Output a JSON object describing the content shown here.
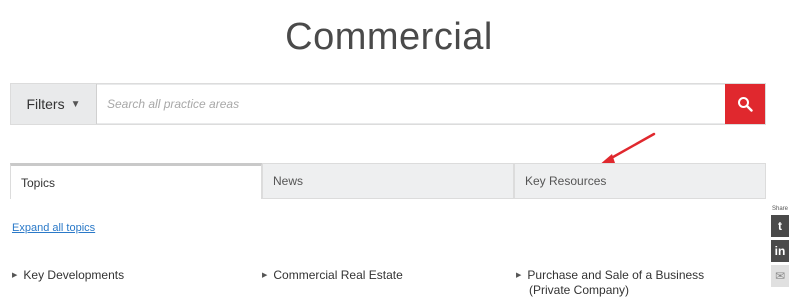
{
  "page_title": "Commercial",
  "filter_bar": {
    "filters_label": "Filters",
    "search_placeholder": "Search all practice areas"
  },
  "tabs": [
    {
      "label": "Topics",
      "active": true
    },
    {
      "label": "News",
      "active": false
    },
    {
      "label": "Key Resources",
      "active": false
    }
  ],
  "expand_link": "Expand all topics",
  "topics": [
    {
      "label": "Key Developments"
    },
    {
      "label": "Commercial Real Estate"
    },
    {
      "label": "Purchase and Sale of a Business",
      "label_cont": "(Private Company)"
    }
  ],
  "share": {
    "label": "Share",
    "buttons": [
      "twitter-icon",
      "linkedin-icon",
      "email-icon"
    ]
  },
  "colors": {
    "search_button": "#e0282e",
    "arrow": "#e0282e",
    "link": "#2a79c8"
  }
}
